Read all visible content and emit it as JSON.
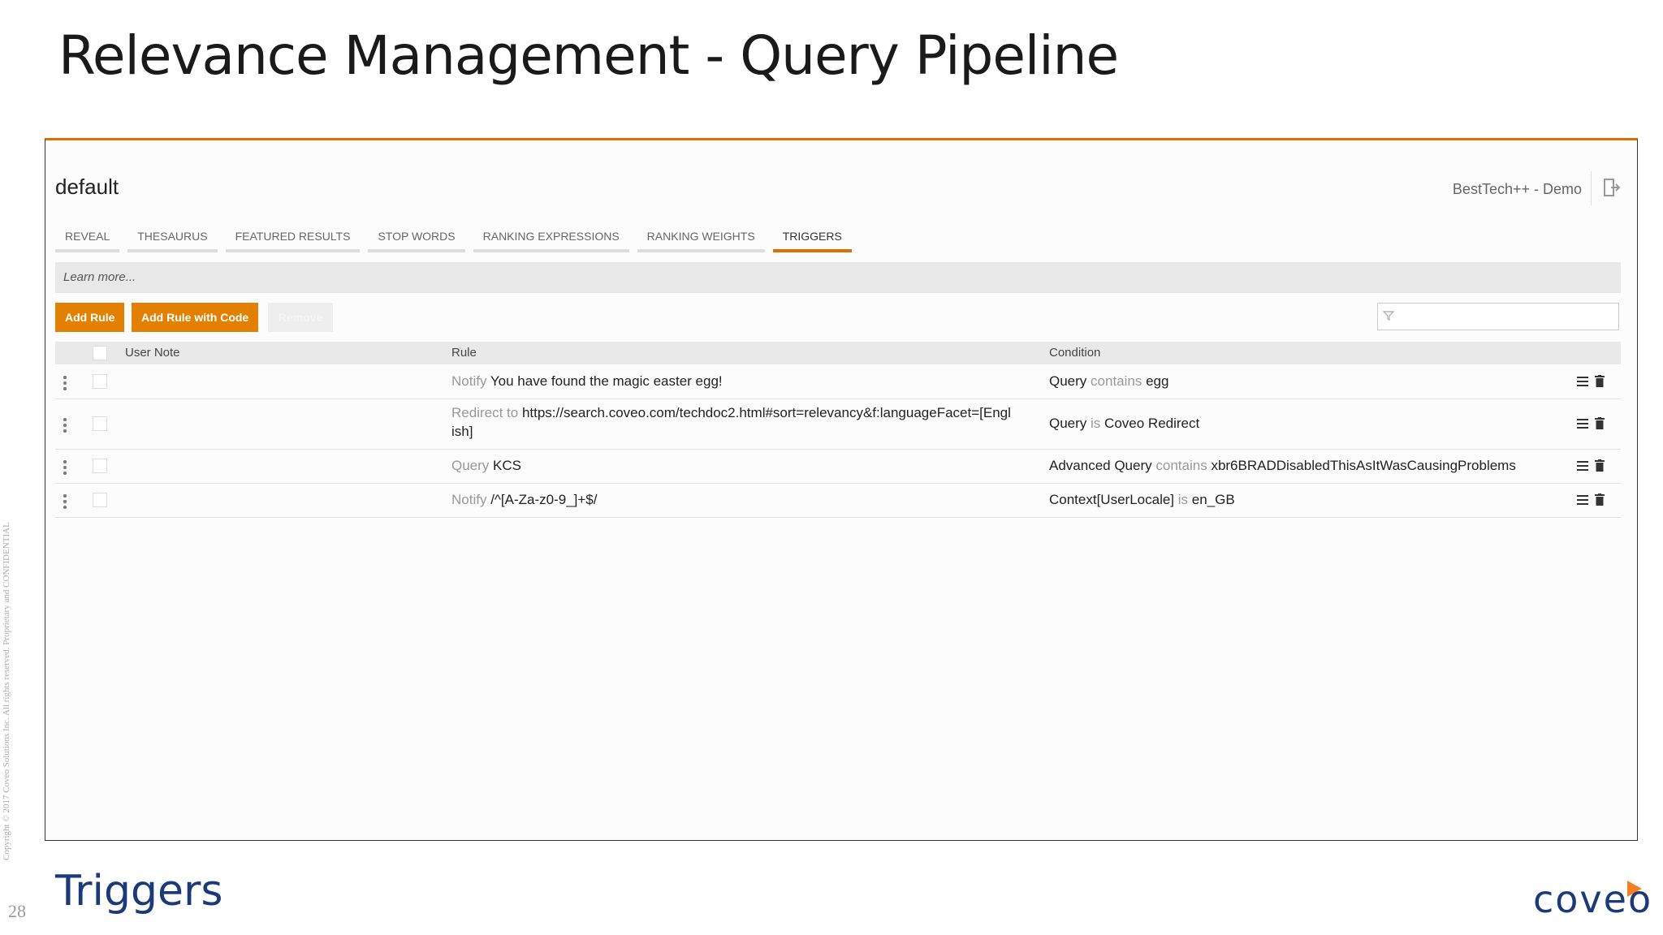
{
  "slide": {
    "title": "Relevance Management - Query Pipeline",
    "section_label": "Triggers",
    "page_number": "28",
    "copyright": "Copyright © 2017 Coveo Solutions Inc.   All rights reserved. Proprietary and CONFIDENTIAL",
    "logo_text": "coveo"
  },
  "app": {
    "pipeline_name": "default",
    "org_name": "BestTech++ - Demo",
    "tabs": [
      {
        "label": "REVEAL"
      },
      {
        "label": "THESAURUS"
      },
      {
        "label": "FEATURED RESULTS"
      },
      {
        "label": "STOP WORDS"
      },
      {
        "label": "RANKING EXPRESSIONS"
      },
      {
        "label": "RANKING WEIGHTS"
      },
      {
        "label": "TRIGGERS",
        "active": true
      }
    ],
    "learn_more": "Learn more...",
    "buttons": {
      "add_rule": "Add Rule",
      "add_rule_code": "Add Rule with Code",
      "remove": "Remove"
    },
    "filter_placeholder": "",
    "table": {
      "headers": {
        "note": "User Note",
        "rule": "Rule",
        "condition": "Condition"
      },
      "rows": [
        {
          "rule_kw": "Notify",
          "rule_val": "You have found the magic easter egg!",
          "cond_a": "Query",
          "cond_op": "contains",
          "cond_b": "egg"
        },
        {
          "rule_kw": "Redirect to",
          "rule_val": "https://search.coveo.com/techdoc2.html#sort=relevancy&f:languageFacet=[English]",
          "cond_a": "Query",
          "cond_op": "is",
          "cond_b": "Coveo Redirect"
        },
        {
          "rule_kw": "Query",
          "rule_val": "KCS",
          "cond_a": "Advanced Query",
          "cond_op": "contains",
          "cond_b": "xbr6BRADDisabledThisAsItWasCausingProblems"
        },
        {
          "rule_kw": "Notify",
          "rule_val": "/^[A-Za-z0-9_]+$/",
          "cond_a": "Context[UserLocale]",
          "cond_op": "is",
          "cond_b": "en_GB"
        }
      ]
    }
  },
  "colors": {
    "accent": "#e48000",
    "brand": "#1b3a7a"
  }
}
